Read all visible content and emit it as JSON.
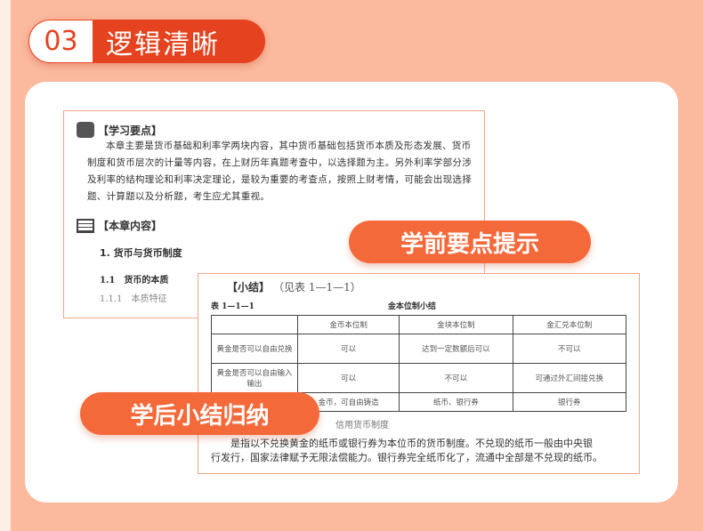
{
  "header": {
    "number": "03",
    "title": "逻辑清晰"
  },
  "doc1": {
    "heading": "【学习要点】",
    "paragraph": "本章主要是货币基础和利率学两块内容，其中货币基础包括货币本质及形态发展、货币制度和货币层次的计量等内容，在上财历年真题考查中，以选择题为主。另外利率学部分涉及利率的结构理论和利率决定理论，是较为重要的考查点，按照上财考情，可能会出现选择题、计算题以及分析题，考生应尤其重视。",
    "contents_heading": "【本章内容】",
    "section": "1. 货币与货币制度",
    "subsection": "1.1　货币的本质",
    "subsubsection": "1.1.1　本质特征"
  },
  "doc2": {
    "heading": "【小结】",
    "heading_ref": "（见表 1—1—1）",
    "table_no": "表 1—1—1",
    "table_title": "金本位制小结",
    "columns": [
      "",
      "金币本位制",
      "金块本位制",
      "金汇兑本位制"
    ],
    "rows": [
      [
        "黄金是否可以自由兑换",
        "可以",
        "达到一定数额后可以",
        "不可以"
      ],
      [
        "黄金是否可以自由输入输出",
        "可以",
        "不可以",
        "可通过外汇间接兑换"
      ],
      [
        "",
        "金币，可自由铸造",
        "纸币、银行券",
        "银行券"
      ]
    ],
    "sub": "信用货币制度",
    "text1": "是指以不兑换黄金的纸币或银行券为本位币的货币制度。不兑现的纸币一般由中央银",
    "text2": "行发行，国家法律赋予无限法偿能力。银行券完全纸币化了，流通中全部是不兑现的纸币。"
  },
  "tags": {
    "before": "学前要点提示",
    "after": "学后小结归纳"
  }
}
